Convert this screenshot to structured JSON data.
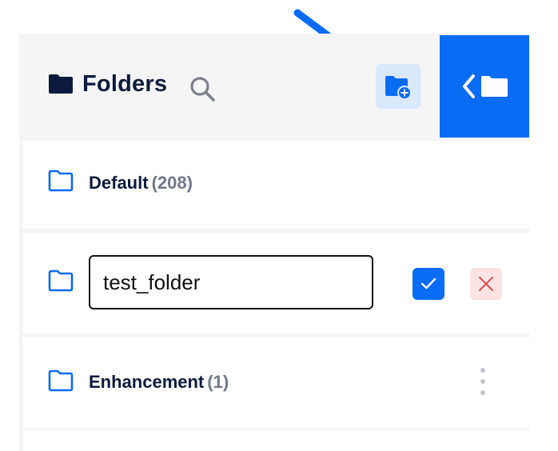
{
  "header": {
    "title": "Folders",
    "title_icon": "folder-icon",
    "search_icon": "search-icon",
    "new_folder_icon": "new-folder-icon",
    "collapse_icon": "chevron-left-folder-icon"
  },
  "folders": [
    {
      "name": "Default",
      "count": "(208)"
    },
    {
      "name": "Enhancement",
      "count": "(1)"
    }
  ],
  "edit_row": {
    "value": "test_folder",
    "confirm_icon": "check-icon",
    "cancel_icon": "close-icon"
  },
  "colors": {
    "accent": "#0a6cf5",
    "title_text": "#0e1a3d",
    "count_text": "#6f7787",
    "new_folder_bg": "#d9e8fb",
    "cancel_bg": "#fbe3e3",
    "cancel_x": "#d33b3b",
    "annotation_arrow": "#0a6cf5"
  }
}
